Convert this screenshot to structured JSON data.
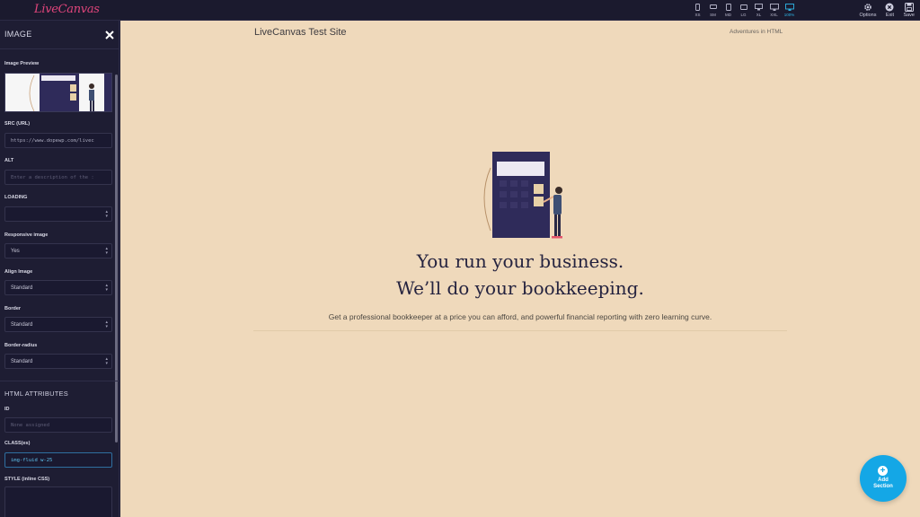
{
  "topbar": {
    "logo": "LiveCanvas",
    "devices": [
      {
        "label": "XS",
        "icon": "phone-portrait-icon"
      },
      {
        "label": "SM",
        "icon": "phone-landscape-icon"
      },
      {
        "label": "MD",
        "icon": "tablet-portrait-icon"
      },
      {
        "label": "LG",
        "icon": "tablet-landscape-icon"
      },
      {
        "label": "XL",
        "icon": "monitor-icon"
      },
      {
        "label": "XXL",
        "icon": "monitor-large-icon"
      },
      {
        "label": "100%",
        "icon": "monitor-full-icon"
      }
    ],
    "active_device": "100%",
    "actions": {
      "options": "Options",
      "exit": "Exit",
      "save": "Save"
    }
  },
  "sidebar": {
    "title": "IMAGE",
    "image_preview_label": "Image Preview",
    "src_label": "SRC (URL)",
    "src_value": "https://www.dopewp.com/livec",
    "alt_label": "ALT",
    "alt_placeholder": "Enter a description of the :",
    "loading_label": "LOADING",
    "loading_value": "",
    "responsive_label": "Responsive image",
    "responsive_value": "Yes",
    "align_label": "Align Image",
    "align_value": "Standard",
    "border_label": "Border",
    "border_value": "Standard",
    "radius_label": "Border-radius",
    "radius_value": "Standard",
    "html_attributes_heading": "HTML ATTRIBUTES",
    "id_label": "ID",
    "id_placeholder": "None assigned",
    "class_label": "CLASS(es)",
    "class_value": "img-fluid w-25",
    "style_label": "STYLE (inline CSS)"
  },
  "canvas": {
    "site_title": "LiveCanvas Test Site",
    "site_tagline": "Adventures in HTML",
    "heading_line1": "You run your business.",
    "heading_line2": "We’ll do your bookkeeping.",
    "paragraph": "Get a professional bookkeeper at a price you can afford, and powerful financial reporting with zero learning curve."
  },
  "fab": {
    "line1": "Add",
    "line2": "Section"
  },
  "colors": {
    "accent": "#14a7e6",
    "sidebar_bg": "#1e1d33",
    "canvas_bg": "#efd9bb",
    "heading": "#25233f",
    "logo": "#e0457b"
  }
}
